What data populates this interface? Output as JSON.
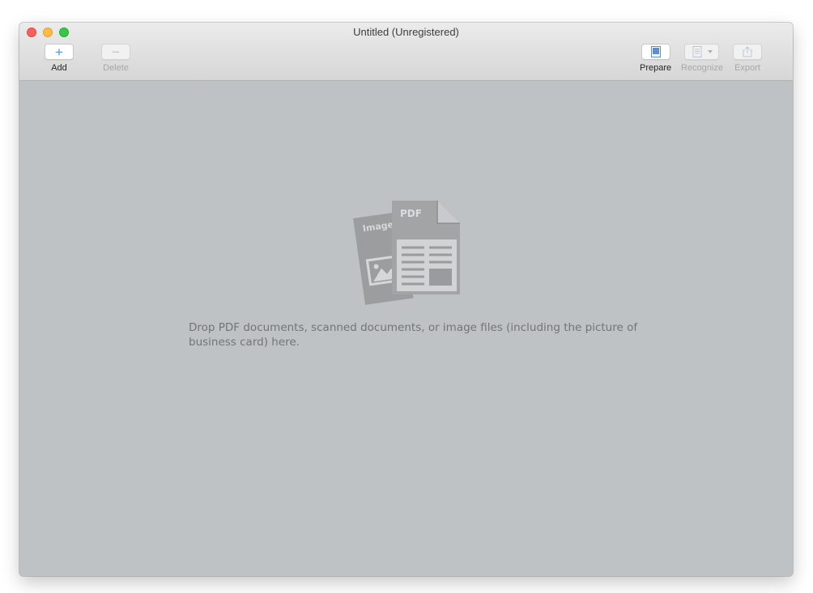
{
  "window": {
    "title": "Untitled (Unregistered)"
  },
  "toolbar": {
    "add_label": "Add",
    "delete_label": "Delete",
    "prepare_label": "Prepare",
    "recognize_label": "Recognize",
    "export_label": "Export",
    "icons": {
      "add": "plus-icon",
      "delete": "minus-icon",
      "prepare": "page-icon",
      "recognize": "document-text-icon",
      "export": "share-icon"
    }
  },
  "drop_area": {
    "message": "Drop PDF documents, scanned documents, or image files (including the picture of business card) here.",
    "illustration_image_label": "Image",
    "illustration_pdf_label": "PDF"
  },
  "colors": {
    "accent": "#5a8fd8",
    "content_background": "#bfc2c5"
  }
}
